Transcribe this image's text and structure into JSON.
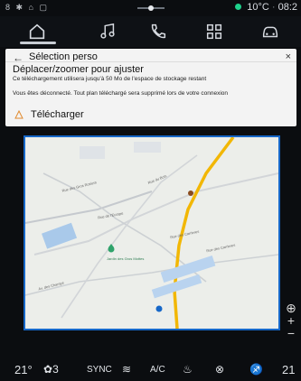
{
  "status": {
    "left_icons": "8 ✱ ⌂ ▢",
    "temp": "10°C",
    "time": "08:2"
  },
  "nav": [
    {
      "icon": "home-icon",
      "active": true
    },
    {
      "icon": "music-icon"
    },
    {
      "icon": "phone-icon"
    },
    {
      "icon": "apps-icon"
    },
    {
      "icon": "car-icon"
    }
  ],
  "panel": {
    "back": "←",
    "title": "Sélection perso",
    "close": "×",
    "heading": "Déplacer/zoomer pour ajuster",
    "storage_note": "Ce téléchargement utilisera jusqu'à 50 Mo de l'espace de stockage restant",
    "disconnect_note": "Vous êtes déconnecté. Tout plan téléchargé sera supprimé lors de votre connexion",
    "download_label": "Télécharger"
  },
  "map": {
    "poi_label": "Jardin des Gros Mottes",
    "street_labels": [
      "Rue des Gros Rosiers",
      "Rue du Bois",
      "Rue de l'Europe",
      "Av. des Champs",
      "Rue des Carrieres",
      "Rue des Carrieres"
    ]
  },
  "zoom": {
    "locate": "⊕",
    "in": "+",
    "out": "−"
  },
  "climate": {
    "left_temp": "21°",
    "fan": "3",
    "sync": "SYNC",
    "ac": "A/C",
    "right_temp": "21"
  },
  "colors": {
    "accent": "#1667c8",
    "route": "#f2b705"
  }
}
